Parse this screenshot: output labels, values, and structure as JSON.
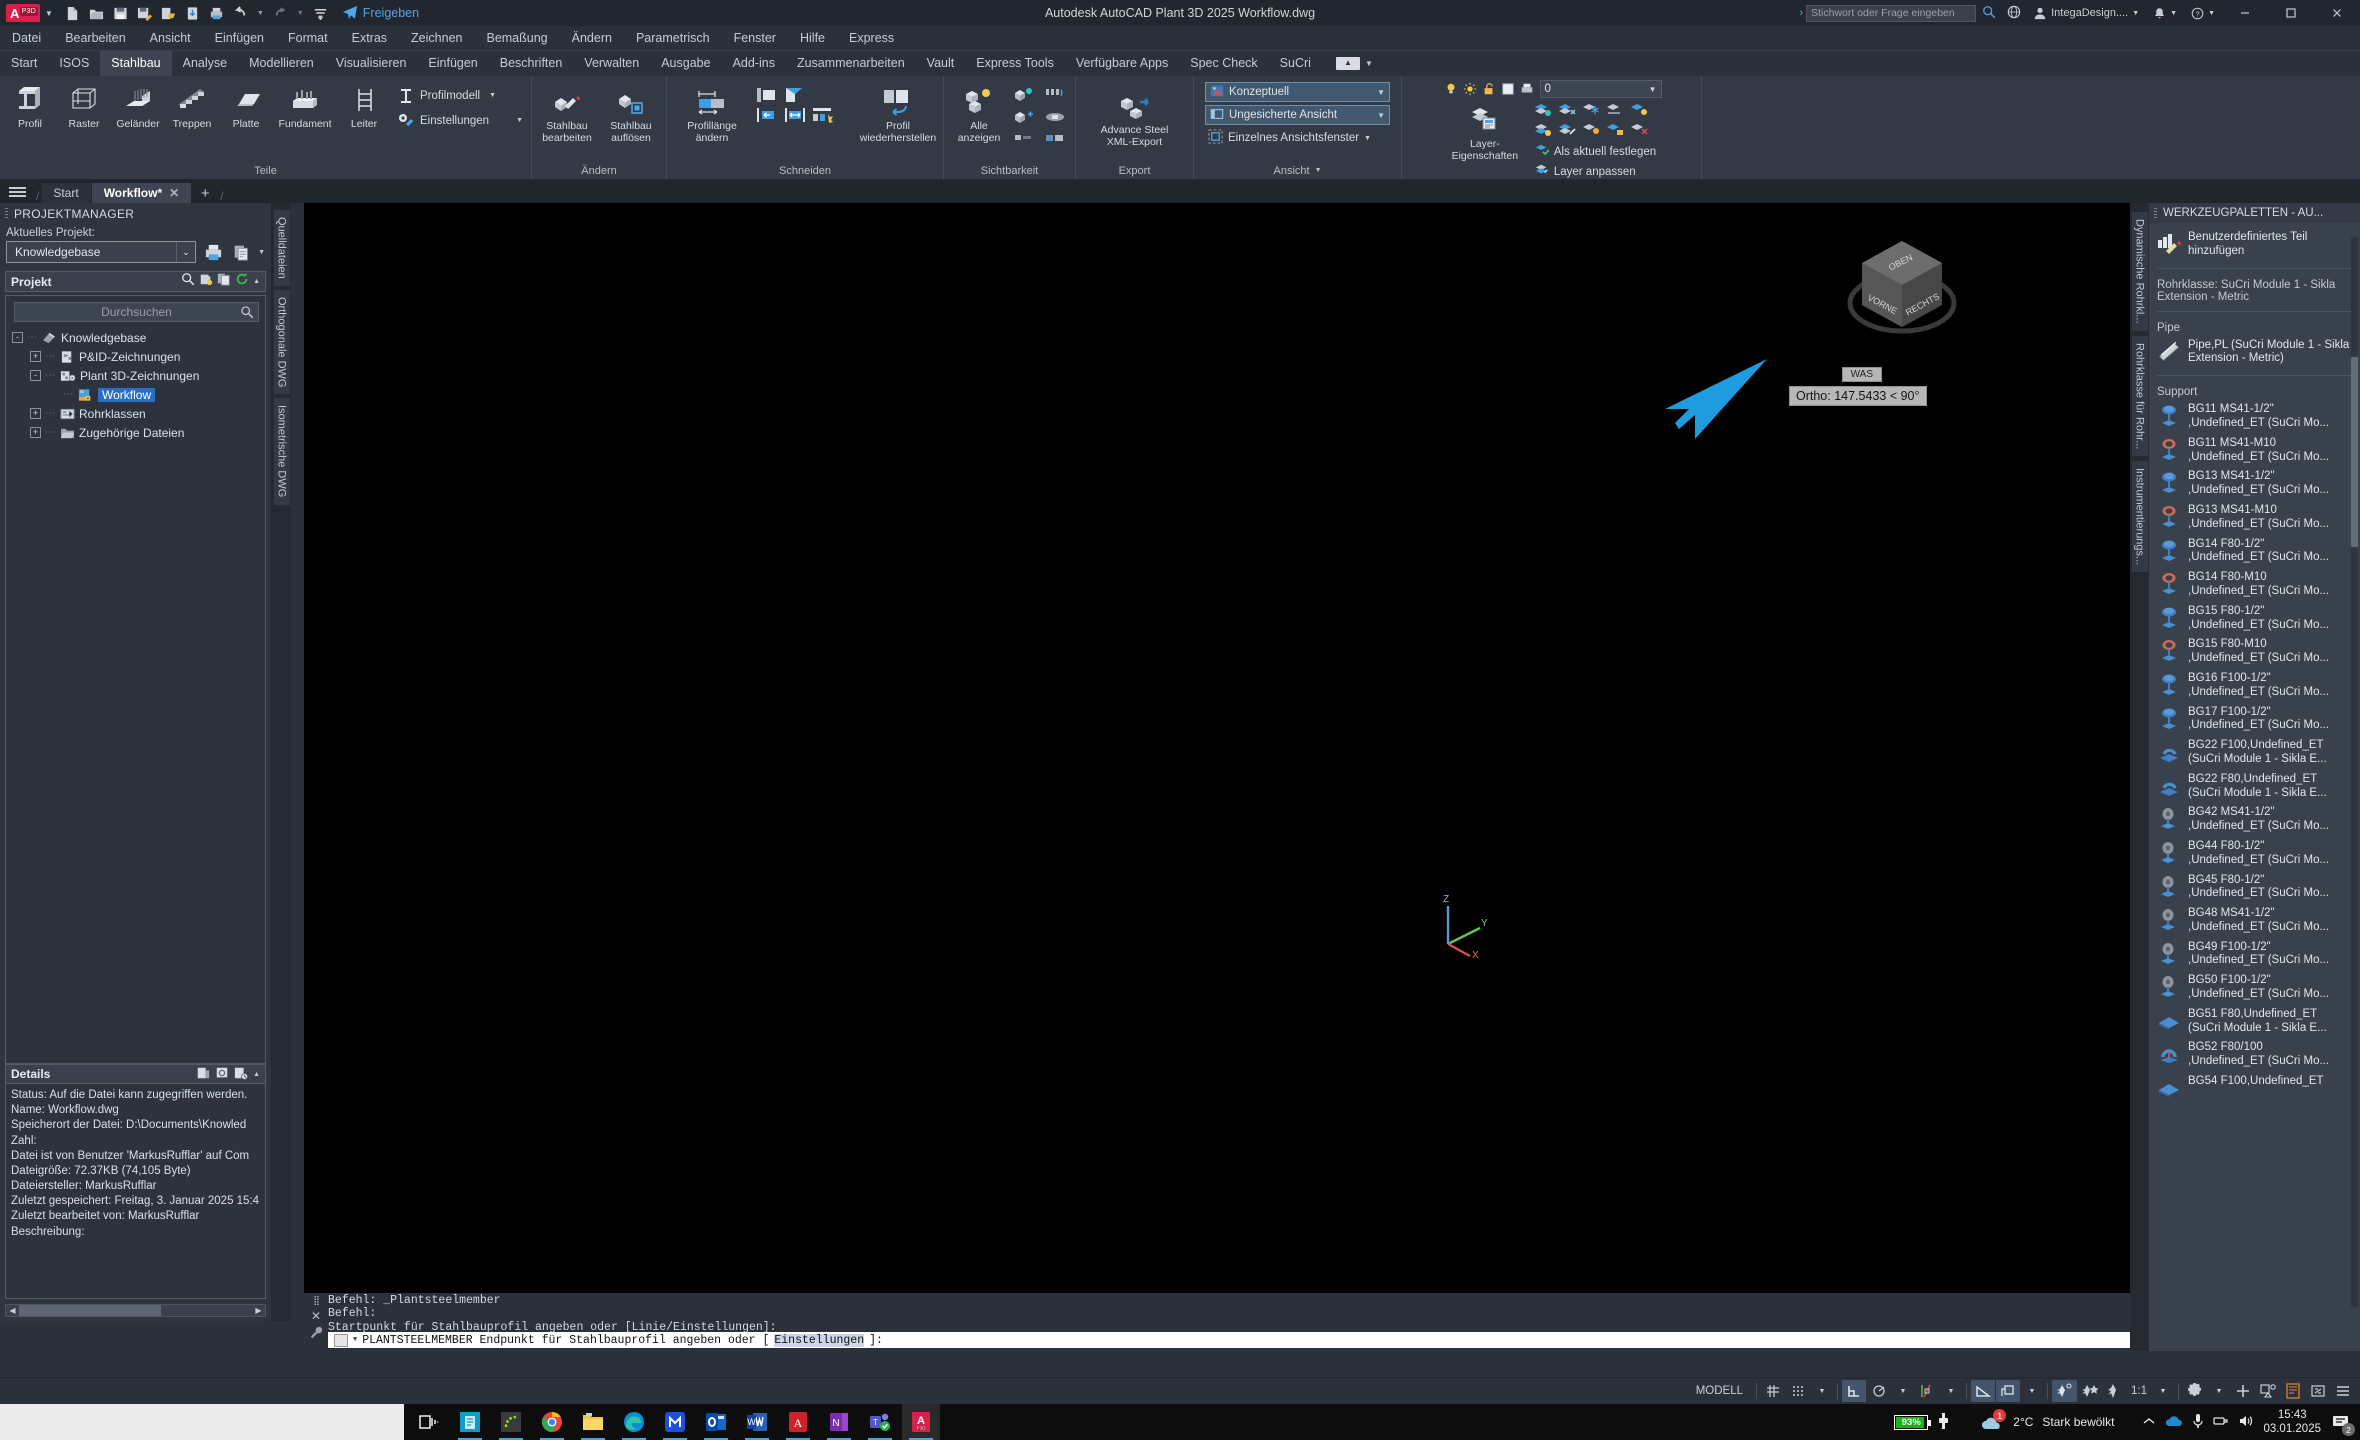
{
  "titlebar": {
    "app_badge": "A",
    "app_badge_sub": "P3D",
    "title": "Autodesk AutoCAD Plant 3D 2025   Workflow.dwg",
    "share_label": "Freigeben",
    "search_placeholder": "Stichwort oder Frage eingeben",
    "account": "IntegaDesign....",
    "quick_icons": [
      "new-icon",
      "open-icon",
      "save-icon",
      "saveas-icon",
      "export-icon",
      "cloud-icon",
      "plot-icon",
      "undo-icon",
      "redo-icon",
      "customize-icon"
    ],
    "window_buttons": [
      "minimize",
      "maximize",
      "close"
    ]
  },
  "menubar": {
    "items": [
      "Datei",
      "Bearbeiten",
      "Ansicht",
      "Einfügen",
      "Format",
      "Extras",
      "Zeichnen",
      "Bemaßung",
      "Ändern",
      "Parametrisch",
      "Fenster",
      "Hilfe",
      "Express"
    ]
  },
  "ribbon_tabs": {
    "items": [
      "Start",
      "ISOS",
      "Stahlbau",
      "Analyse",
      "Modellieren",
      "Visualisieren",
      "Einfügen",
      "Beschriften",
      "Verwalten",
      "Ausgabe",
      "Add-ins",
      "Zusammenarbeiten",
      "Vault",
      "Express Tools",
      "Verfügbare Apps",
      "Spec Check",
      "SuCri"
    ],
    "active": "Stahlbau"
  },
  "ribbon": {
    "panels": [
      {
        "title": "Teile",
        "big_buttons": [
          {
            "label": "Profil",
            "icon": "ibeam-icon"
          },
          {
            "label": "Raster",
            "icon": "grid-frame-icon"
          },
          {
            "label": "Geländer",
            "icon": "railing-icon"
          },
          {
            "label": "Treppen",
            "icon": "stairs-icon"
          },
          {
            "label": "Platte",
            "icon": "plate-icon"
          },
          {
            "label": "Fundament",
            "icon": "foundation-icon"
          },
          {
            "label": "Leiter",
            "icon": "ladder-icon"
          }
        ],
        "small_buttons": [
          {
            "label": "Profilmodell",
            "icon": "profile-model-icon",
            "has_caret": true
          },
          {
            "label": "Einstellungen",
            "icon": "settings-wrench-icon",
            "has_caret": true
          }
        ]
      },
      {
        "title": "Ändern",
        "big_buttons": [
          {
            "label": "Stahlbau bearbeiten",
            "icon": "edit-steel-icon"
          },
          {
            "label": "Stahlbau auflösen",
            "icon": "explode-steel-icon"
          }
        ],
        "small_buttons": []
      },
      {
        "title": "Schneiden",
        "big_buttons": [
          {
            "label": "Profillänge ändern",
            "icon": "change-length-icon"
          },
          {
            "label": "Profil wiederherstellen",
            "icon": "restore-profile-icon"
          }
        ],
        "tool_icons": [
          "cut-start-icon",
          "cut-angle-icon",
          "shorten-left-icon",
          "lengthen-icon",
          "trim-multi-icon"
        ],
        "small_buttons": []
      },
      {
        "title": "Sichtbarkeit",
        "big_buttons": [
          {
            "label": "Alle anzeigen",
            "icon": "show-all-icon"
          }
        ],
        "tool_icons": [
          "isolate-icon",
          "hide-icon",
          "unhide-icon",
          "fade-icon",
          "dim-icon",
          "toggle-icon"
        ],
        "small_buttons": []
      },
      {
        "title": "Export",
        "big_buttons": [
          {
            "label": "Advance Steel XML-Export",
            "icon": "xml-export-icon"
          }
        ],
        "small_buttons": []
      },
      {
        "title": "Ansicht",
        "has_title_caret": true,
        "combos": [
          {
            "label": "Konzeptuell",
            "icon": "visual-style-icon",
            "selected": true
          },
          {
            "label": "Ungesicherte Ansicht",
            "icon": "view-icon",
            "selected": false
          }
        ],
        "line_items": [
          {
            "label": "Einzelnes Ansichtsfenster",
            "icon": "viewport-icon",
            "has_caret": true
          }
        ]
      },
      {
        "title": "Layer",
        "has_title_caret": true,
        "big_buttons": [
          {
            "label": "Layer-Eigenschaften",
            "icon": "layer-properties-icon"
          }
        ],
        "layer_combo_value": "0",
        "line_items": [
          {
            "label": "Als aktuell festlegen",
            "icon": "set-current-icon"
          },
          {
            "label": "Layer anpassen",
            "icon": "match-layer-icon"
          }
        ]
      }
    ]
  },
  "filetabs": {
    "tabs": [
      {
        "label": "Start",
        "active": false,
        "closable": false
      },
      {
        "label": "Workflow*",
        "active": true,
        "closable": true
      }
    ],
    "add_label": "+"
  },
  "project_manager": {
    "panel_title": "PROJEKTMANAGER",
    "current_project_label": "Aktuelles Projekt:",
    "current_project_value": "Knowledgebase",
    "section_title": "Projekt",
    "search_placeholder": "Durchsuchen",
    "tree": [
      {
        "label": "Knowledgebase",
        "depth": 0,
        "expander": "-",
        "icon": "project-icon",
        "selected": false
      },
      {
        "label": "P&ID-Zeichnungen",
        "depth": 1,
        "expander": "+",
        "icon": "pid-folder-icon",
        "selected": false
      },
      {
        "label": "Plant 3D-Zeichnungen",
        "depth": 1,
        "expander": "-",
        "icon": "plant3d-folder-icon",
        "selected": false
      },
      {
        "label": "Workflow",
        "depth": 2,
        "expander": "",
        "icon": "dwg-lock-icon",
        "selected": true
      },
      {
        "label": "Rohrklassen",
        "depth": 1,
        "expander": "+",
        "icon": "specs-icon",
        "selected": false
      },
      {
        "label": "Zugehörige Dateien",
        "depth": 1,
        "expander": "+",
        "icon": "folder-icon",
        "selected": false
      }
    ],
    "details_title": "Details",
    "details_lines": [
      "Status: Auf die Datei kann zugegriffen werden.",
      "Name: Workflow.dwg",
      "Speicherort der Datei: D:\\Documents\\Knowled",
      "Zahl:",
      "Datei ist von Benutzer 'MarkusRufflar' auf Com",
      "Dateigröße: 72.37KB (74,105 Byte)",
      "Dateiersteller:  MarkusRufflar",
      "Zuletzt gespeichert: Freitag, 3. Januar 2025 15:4",
      "Zuletzt bearbeitet von: MarkusRufflar",
      "Beschreibung:"
    ]
  },
  "side_tabs": [
    "Quelldateien",
    "Orthogonale DWG",
    "Isometrische DWG"
  ],
  "canvas": {
    "ortho_tooltip": "Ortho: 147.5433 < 90°",
    "viewcube_faces": [
      "OBEN",
      "VORNE",
      "RECHTS"
    ],
    "was_tag": "WAS",
    "ucs_axes": [
      "Z",
      "Y",
      "X"
    ]
  },
  "command_line": {
    "history": [
      "Befehl: _Plantsteelmember",
      "Befehl:",
      "Startpunkt für Stahlbauprofil angeben oder [Linie/Einstellungen]:"
    ],
    "prompt_prefix": "PLANTSTEELMEMBER Endpunkt für Stahlbauprofil angeben oder [",
    "prompt_highlight": "Einstellungen",
    "prompt_suffix": "]:"
  },
  "tool_palette": {
    "panel_title": "WERKZEUGPALETTEN - AU...",
    "add_custom_part": "Benutzerdefiniertes Teil hinzufügen",
    "spec_label": "Rohrklasse: SuCri Module 1 - Sikla Extension - Metric",
    "group_pipe": "Pipe",
    "pipe_item": "Pipe,PL (SuCri Module 1 - Sikla Extension - Metric)",
    "group_support": "Support",
    "supports": [
      {
        "name": "BG11 MS41-1/2\"",
        "sub": ",Undefined_ET (SuCri Mo...",
        "icon": "clamp-blue-icon"
      },
      {
        "name": "BG11 MS41-M10",
        "sub": ",Undefined_ET (SuCri Mo...",
        "icon": "clamp-red-icon"
      },
      {
        "name": "BG13 MS41-1/2\"",
        "sub": ",Undefined_ET (SuCri Mo...",
        "icon": "clamp-blue-icon"
      },
      {
        "name": "BG13 MS41-M10",
        "sub": ",Undefined_ET (SuCri Mo...",
        "icon": "clamp-red-icon"
      },
      {
        "name": "BG14 F80-1/2\"",
        "sub": ",Undefined_ET (SuCri Mo...",
        "icon": "clamp-blue-icon"
      },
      {
        "name": "BG14 F80-M10",
        "sub": ",Undefined_ET (SuCri Mo...",
        "icon": "clamp-red-icon"
      },
      {
        "name": "BG15 F80-1/2\"",
        "sub": ",Undefined_ET (SuCri Mo...",
        "icon": "clamp-blue-icon"
      },
      {
        "name": "BG15 F80-M10",
        "sub": ",Undefined_ET (SuCri Mo...",
        "icon": "clamp-red-icon"
      },
      {
        "name": "BG16 F100-1/2\"",
        "sub": ",Undefined_ET (SuCri Mo...",
        "icon": "clamp-blue-icon"
      },
      {
        "name": "BG17 F100-1/2\"",
        "sub": ",Undefined_ET (SuCri Mo...",
        "icon": "clamp-blue-icon"
      },
      {
        "name": "BG22 F100,Undefined_ET",
        "sub": "(SuCri Module 1 - Sikla E...",
        "icon": "bracket-icon"
      },
      {
        "name": "BG22 F80,Undefined_ET",
        "sub": "(SuCri Module 1 - Sikla E...",
        "icon": "bracket-icon"
      },
      {
        "name": "BG42 MS41-1/2\"",
        "sub": ",Undefined_ET (SuCri Mo...",
        "icon": "disc-gray-icon"
      },
      {
        "name": "BG44 F80-1/2\"",
        "sub": ",Undefined_ET (SuCri Mo...",
        "icon": "disc-gray-icon"
      },
      {
        "name": "BG45 F80-1/2\"",
        "sub": ",Undefined_ET (SuCri Mo...",
        "icon": "disc-gray-icon"
      },
      {
        "name": "BG48 MS41-1/2\"",
        "sub": ",Undefined_ET (SuCri Mo...",
        "icon": "disc-gray-icon"
      },
      {
        "name": "BG49 F100-1/2\"",
        "sub": ",Undefined_ET (SuCri Mo...",
        "icon": "disc-gray-icon"
      },
      {
        "name": "BG50 F100-1/2\"",
        "sub": ",Undefined_ET (SuCri Mo...",
        "icon": "disc-gray-icon"
      },
      {
        "name": "BG51 F80,Undefined_ET",
        "sub": "(SuCri Module 1 - Sikla E...",
        "icon": "plate-blue-icon"
      },
      {
        "name": "BG52 F80/100",
        "sub": ",Undefined_ET (SuCri Mo...",
        "icon": "saddle-icon"
      },
      {
        "name": "BG54 F100,Undefined_ET",
        "sub": "",
        "icon": "plate-blue-icon"
      }
    ],
    "vertical_tabs": [
      "Dynamische Rohrkl...",
      "Rohrklasse für Rohr...",
      "Instrumentierungs..."
    ]
  },
  "statusbar": {
    "model_label": "MODELL",
    "scale": "1:1",
    "toggles": [
      {
        "name": "grid-icon",
        "on": false
      },
      {
        "name": "snap-icon",
        "on": false
      },
      {
        "name": "ortho-icon",
        "on": true
      },
      {
        "name": "polar-icon",
        "on": false
      },
      {
        "name": "osnap-icon",
        "on": false
      },
      {
        "name": "angle-icon",
        "on": true
      },
      {
        "name": "ucs-icon",
        "on": true
      },
      {
        "name": "dynamic-ucs-icon",
        "on": true
      },
      {
        "name": "annotation-visibility-icon",
        "on": false
      },
      {
        "name": "annotation-scale-icon",
        "on": false
      }
    ],
    "right_icons": [
      "gear-icon",
      "plus-icon",
      "isolate-icon",
      "layout-icon",
      "fullscreen-icon",
      "customize-icon"
    ]
  },
  "taskbar": {
    "search_placeholder": "",
    "apps": [
      {
        "name": "task-view-icon",
        "open": false
      },
      {
        "name": "app-teal-icon",
        "open": true
      },
      {
        "name": "app-green-icon",
        "open": true
      },
      {
        "name": "chrome-icon",
        "open": true
      },
      {
        "name": "file-explorer-icon",
        "open": true
      },
      {
        "name": "edge-icon",
        "open": true
      },
      {
        "name": "app-m-icon",
        "open": true
      },
      {
        "name": "outlook-icon",
        "open": true
      },
      {
        "name": "word-icon",
        "open": true
      },
      {
        "name": "acrobat-icon",
        "open": true
      },
      {
        "name": "onenote-icon",
        "open": true
      },
      {
        "name": "teams-icon",
        "open": true
      },
      {
        "name": "autocad-icon",
        "open": true,
        "active": true
      }
    ],
    "battery_percent": "93%",
    "weather_temp": "2°C",
    "weather_desc": "Stark bewölkt",
    "weather_badge": "1",
    "time": "15:43",
    "date": "03.01.2025",
    "notification_count": "2"
  },
  "colors": {
    "accent_blue": "#2b6fc4",
    "cursor_blue": "#1f9ce0",
    "ribbon_bg": "#333a45",
    "canvas_bg": "#000000",
    "battery_green": "#16b516"
  }
}
